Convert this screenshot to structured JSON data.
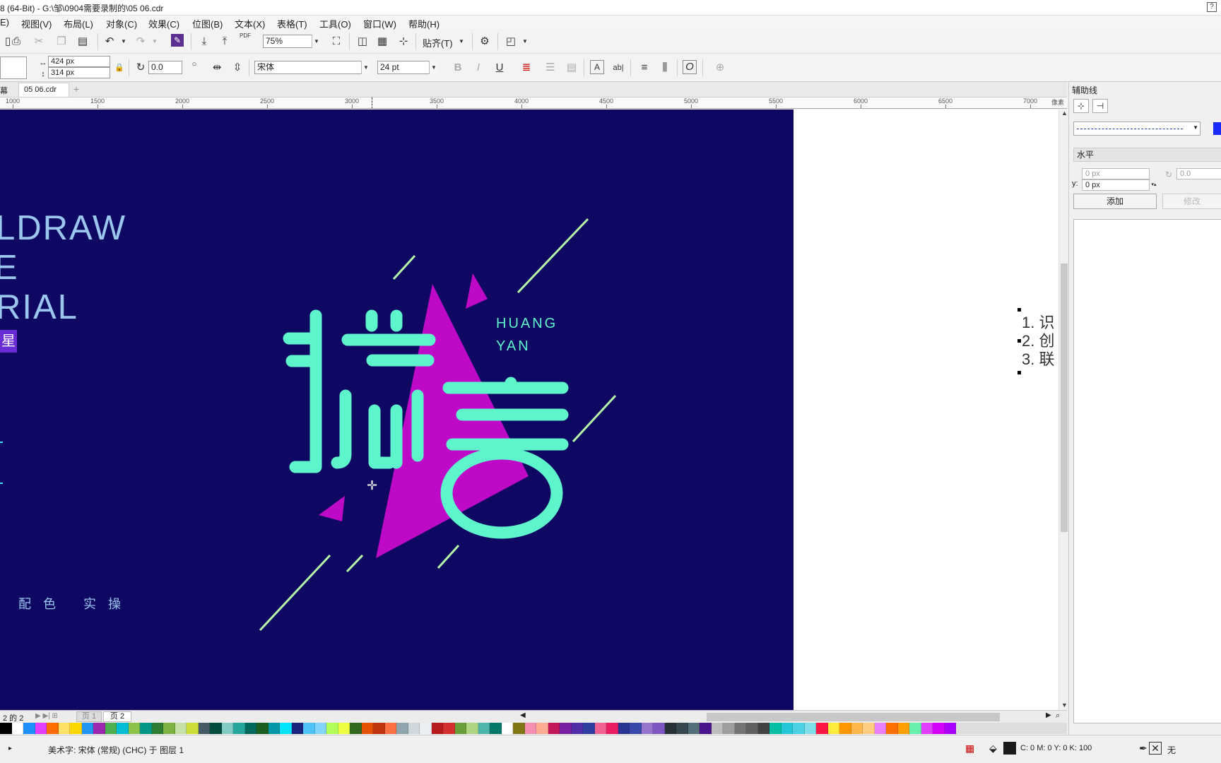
{
  "window": {
    "title": "8 (64-Bit) - G:\\邹\\0904需要录制的\\05 06.cdr",
    "help_icon": "?"
  },
  "menu": [
    "E)",
    "视图(V)",
    "布局(L)",
    "对象(C)",
    "效果(C)",
    "位图(B)",
    "文本(X)",
    "表格(T)",
    "工具(O)",
    "窗口(W)",
    "帮助(H)"
  ],
  "toolbar1": {
    "zoom_value": "75%",
    "snap_label": "贴齐(T)",
    "pdf_label": "PDF"
  },
  "toolbar2": {
    "width_value": "424 px",
    "height_value": "314 px",
    "rotation_value": "0.0",
    "font_name": "宋体",
    "font_size": "24 pt",
    "bold": "B",
    "italic": "I",
    "underline": "U"
  },
  "tabs": {
    "welcome": "幕",
    "doc": "05 06.cdr",
    "add": "+"
  },
  "ruler": {
    "unit": "像素",
    "labels": [
      "1000",
      "1500",
      "2000",
      "2500",
      "3000",
      "3500",
      "4000",
      "4500",
      "5000",
      "5500",
      "6000",
      "6500",
      "7000"
    ]
  },
  "artwork": {
    "line1": "LDRAW",
    "line2": "E",
    "line3": "RIAL",
    "badge": "星",
    "footer": "配 色   实 操",
    "eng_line1": "HUANG",
    "eng_line2": "YAN",
    "colors": {
      "background": "#0f0862",
      "magenta": "#be09c7",
      "mint": "#5ef5cc",
      "line_green": "#b6f7a8",
      "badge": "#6a2cd4",
      "pale_text": "#9bc6ee"
    }
  },
  "side_text": {
    "items": [
      "1. 识",
      "2. 创",
      "3. 联"
    ]
  },
  "pager": {
    "count": "2 的 2",
    "page1": "页 1",
    "page2": "页 2"
  },
  "palette": [
    "#000000",
    "#ffffff",
    "#1e90ff",
    "#e040fb",
    "#ff6b00",
    "#ffe066",
    "#ffd700",
    "#2196f3",
    "#9c27b0",
    "#4caf50",
    "#00bcd4",
    "#8bc34a",
    "#009688",
    "#2e7d32",
    "#7cb342",
    "#c5e1a5",
    "#cddc39",
    "#455a64",
    "#004d40",
    "#80cbc4",
    "#26a69a",
    "#00695c",
    "#1b5e20",
    "#0097a7",
    "#00e5ff",
    "#1a237e",
    "#4fc3f7",
    "#81d4fa",
    "#b2ff59",
    "#eeff41",
    "#33691e",
    "#e65100",
    "#bf360c",
    "#ff7043",
    "#90a4ae",
    "#cfd8dc",
    "#eceff1",
    "#b71c1c",
    "#d32f2f",
    "#689f38",
    "#aed581",
    "#4db6ac",
    "#00796b",
    "#ffffff",
    "#827717",
    "#f48fb1",
    "#ffab91",
    "#c2185b",
    "#7b1fa2",
    "#512da8",
    "#303f9f",
    "#f06292",
    "#e91e63",
    "#283593",
    "#3949ab",
    "#9575cd",
    "#7e57c2",
    "#263238",
    "#37474f",
    "#546e7a",
    "#4a148c",
    "#bdbdbd",
    "#9e9e9e",
    "#757575",
    "#616161",
    "#424242",
    "#00bfa5",
    "#26c6da",
    "#4dd0e1",
    "#80deea",
    "#ff1744",
    "#ffeb3b",
    "#ff9800",
    "#ffb74d",
    "#ffcc80",
    "#ea80fc",
    "#ff6f00",
    "#ffa000",
    "#69f0ae",
    "#e040fb",
    "#d500f9",
    "#aa00ff"
  ],
  "status": {
    "object_info": "美术字: 宋体 (常规) (CHC) 于 图层 1",
    "fill_info": "C: 0 M: 0 Y: 0 K: 100",
    "outline_info": "无"
  },
  "docker": {
    "title": "辅助线",
    "orientation": "水平",
    "x_value": "0 px",
    "y_label": "y:",
    "y_value": "0 px",
    "angle_value": "0.0",
    "add_label": "添加",
    "modify_label": "修改"
  }
}
